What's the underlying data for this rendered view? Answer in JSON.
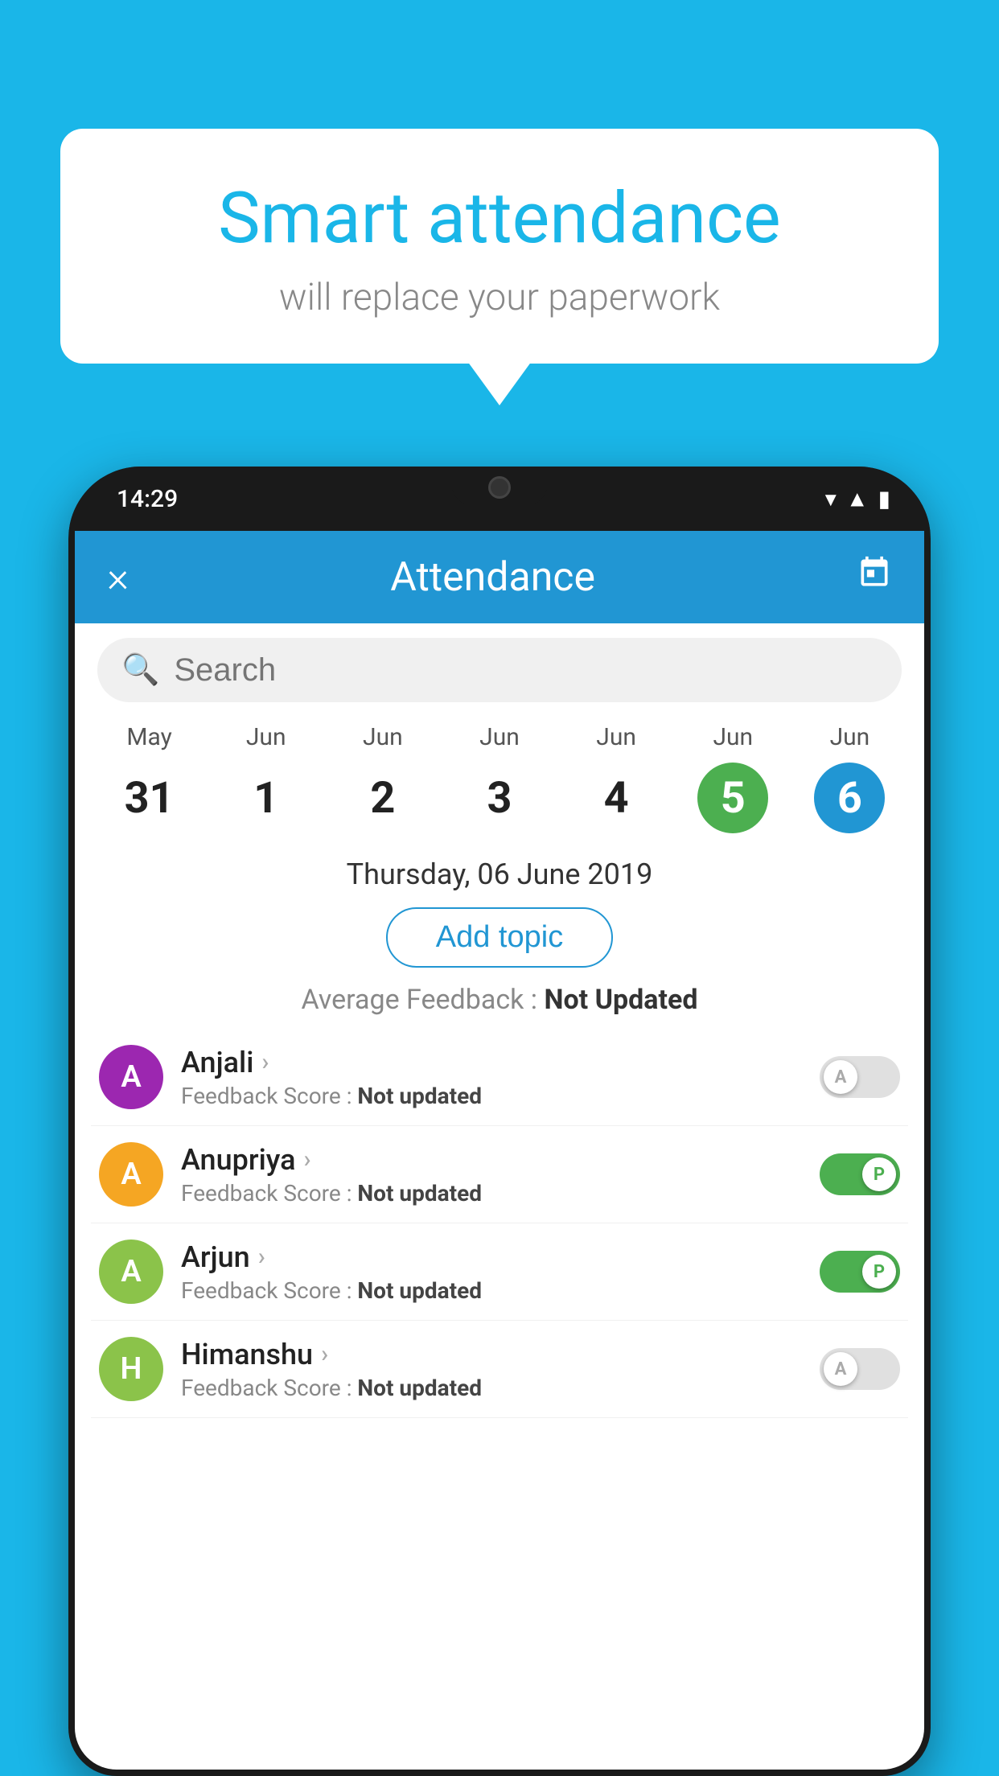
{
  "background_color": "#1ab6e8",
  "bubble": {
    "title": "Smart attendance",
    "subtitle": "will replace your paperwork"
  },
  "phone": {
    "status_time": "14:29",
    "header": {
      "title": "Attendance",
      "close_label": "×",
      "calendar_icon": "calendar-icon"
    },
    "search": {
      "placeholder": "Search"
    },
    "calendar": {
      "months": [
        "May",
        "Jun",
        "Jun",
        "Jun",
        "Jun",
        "Jun",
        "Jun"
      ],
      "dates": [
        "31",
        "1",
        "2",
        "3",
        "4",
        "5",
        "6"
      ],
      "states": [
        "normal",
        "normal",
        "normal",
        "normal",
        "normal",
        "today",
        "selected"
      ]
    },
    "selected_date": "Thursday, 06 June 2019",
    "add_topic_label": "Add topic",
    "average_feedback_label": "Average Feedback :",
    "average_feedback_value": "Not Updated",
    "students": [
      {
        "name": "Anjali",
        "avatar_letter": "A",
        "avatar_color": "#9c27b0",
        "feedback_label": "Feedback Score :",
        "feedback_value": "Not updated",
        "toggle_state": "off",
        "toggle_label": "A"
      },
      {
        "name": "Anupriya",
        "avatar_letter": "A",
        "avatar_color": "#f5a623",
        "feedback_label": "Feedback Score :",
        "feedback_value": "Not updated",
        "toggle_state": "on",
        "toggle_label": "P"
      },
      {
        "name": "Arjun",
        "avatar_letter": "A",
        "avatar_color": "#8bc34a",
        "feedback_label": "Feedback Score :",
        "feedback_value": "Not updated",
        "toggle_state": "on",
        "toggle_label": "P"
      },
      {
        "name": "Himanshu",
        "avatar_letter": "H",
        "avatar_color": "#8bc34a",
        "feedback_label": "Feedback Score :",
        "feedback_value": "Not updated",
        "toggle_state": "off",
        "toggle_label": "A"
      }
    ]
  }
}
